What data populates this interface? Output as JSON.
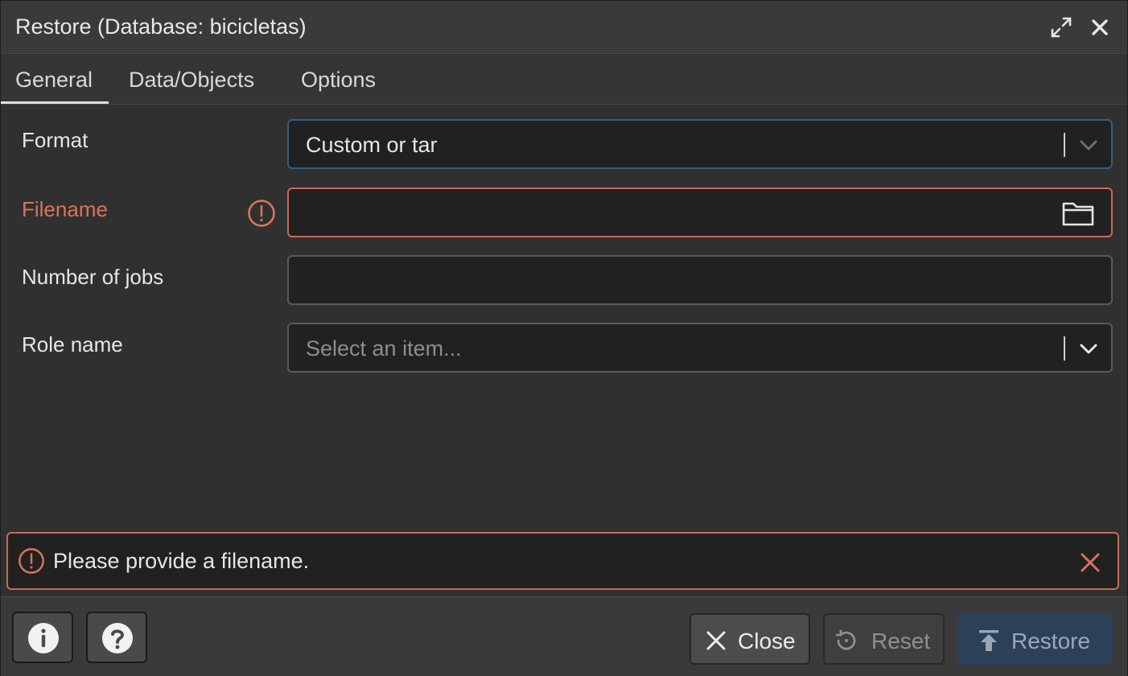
{
  "dialog": {
    "title": "Restore (Database: bicicletas)"
  },
  "tabs": [
    {
      "label": "General",
      "active": true
    },
    {
      "label": "Data/Objects",
      "active": false
    },
    {
      "label": "Options",
      "active": false
    }
  ],
  "form": {
    "format": {
      "label": "Format",
      "value": "Custom or tar"
    },
    "filename": {
      "label": "Filename",
      "value": ""
    },
    "jobs": {
      "label": "Number of jobs",
      "value": ""
    },
    "role": {
      "label": "Role name",
      "placeholder": "Select an item..."
    }
  },
  "alert": {
    "message": "Please provide a filename."
  },
  "footer": {
    "close_label": "Close",
    "reset_label": "Reset",
    "restore_label": "Restore"
  },
  "colors": {
    "error": "#c9695a",
    "focus": "#2f5f86",
    "primary_button": "#2c4157"
  }
}
